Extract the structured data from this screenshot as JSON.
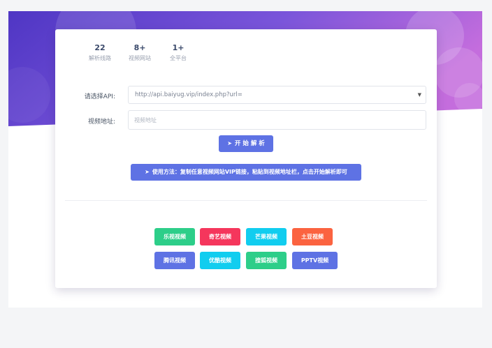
{
  "stats": [
    {
      "num": "22",
      "label": "解析线路"
    },
    {
      "num": "8+",
      "label": "视频网站"
    },
    {
      "num": "1+",
      "label": "全平台"
    }
  ],
  "form": {
    "api_label": "请选择API:",
    "api_value": "http://api.baiyug.vip/index.php?url=",
    "url_label": "视频地址:",
    "url_placeholder": "视频地址"
  },
  "buttons": {
    "parse": "开 始 解 析",
    "usage": "使用方法：复制任意视频网站VIP链接，粘贴到视频地址栏，点击开始解析即可"
  },
  "sites": {
    "row1": [
      "乐视视频",
      "奇艺视频",
      "芒果视频",
      "土豆视频"
    ],
    "row2": [
      "腾讯视频",
      "优酷视频",
      "搜狐视频",
      "PPTV视频"
    ]
  },
  "icons": {
    "send": "paper-plane-icon",
    "caret": "chevron-down-icon"
  },
  "colors": {
    "primary": "#5e72e4",
    "green": "#2dce89",
    "red": "#f5365c",
    "cyan": "#11cdef",
    "orange": "#fb6340",
    "hero_start": "#5b3fd6",
    "hero_end": "#c26ddc"
  }
}
